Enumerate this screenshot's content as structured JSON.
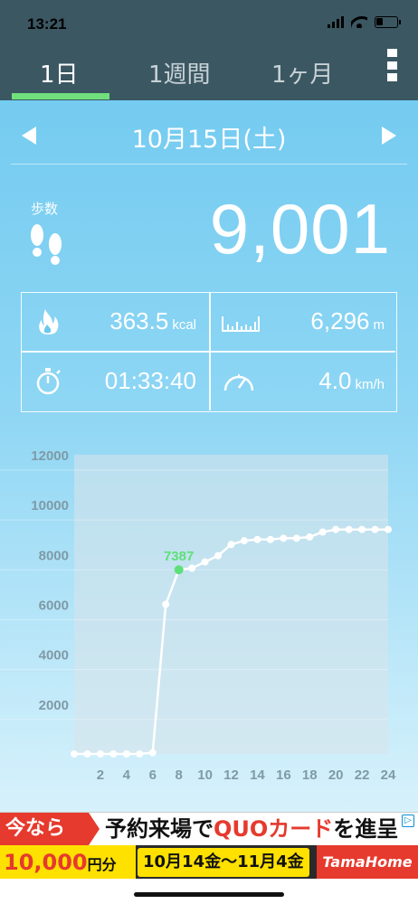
{
  "status_bar": {
    "time": "13:21"
  },
  "tabs": [
    {
      "label": "1日",
      "active": true
    },
    {
      "label": "1週間",
      "active": false
    },
    {
      "label": "1ヶ月",
      "active": false
    }
  ],
  "date_nav": {
    "date": "10月15日(土)"
  },
  "steps": {
    "label": "歩数",
    "value": "9,001"
  },
  "stats": {
    "calories": {
      "value": "363.5",
      "unit": "kcal",
      "icon": "fire-icon"
    },
    "distance": {
      "value": "6,296",
      "unit": "m",
      "icon": "ruler-icon"
    },
    "duration": {
      "value": "01:33:40",
      "icon": "stopwatch-icon"
    },
    "speed": {
      "value": "4.0",
      "unit": "km/h",
      "icon": "speedometer-icon"
    }
  },
  "chart_data": {
    "type": "line",
    "x": [
      0,
      1,
      2,
      3,
      4,
      5,
      6,
      7,
      8,
      9,
      10,
      11,
      12,
      13,
      14,
      15,
      16,
      17,
      18,
      19,
      20,
      21,
      22,
      23,
      24
    ],
    "values": [
      0,
      0,
      0,
      0,
      0,
      0,
      50,
      6000,
      7387,
      7450,
      7700,
      7950,
      8400,
      8550,
      8600,
      8600,
      8650,
      8650,
      8700,
      8900,
      9001,
      9001,
      9001,
      9001,
      9001
    ],
    "highlight": {
      "x": 8,
      "label": "7387"
    },
    "x_tick_labels": [
      "2",
      "4",
      "6",
      "8",
      "10",
      "12",
      "14",
      "16",
      "18",
      "20",
      "22",
      "24"
    ],
    "y_tick_labels": [
      "12000",
      "10000",
      "8000",
      "6000",
      "4000",
      "2000"
    ],
    "ylim": [
      0,
      12000
    ],
    "xlim": [
      0,
      24
    ],
    "grid": true,
    "colors": {
      "line": "#ffffff",
      "highlight": "#5de07a",
      "area": "#d8e4ea"
    }
  },
  "ad": {
    "tag": "今なら",
    "message_prefix": "予約来場で",
    "message_accent": "QUOカード",
    "message_suffix": "を進呈",
    "amount": "10,000",
    "amount_unit": "円分",
    "period": "10月14金〜11月4金",
    "brand": "TamaHome"
  }
}
